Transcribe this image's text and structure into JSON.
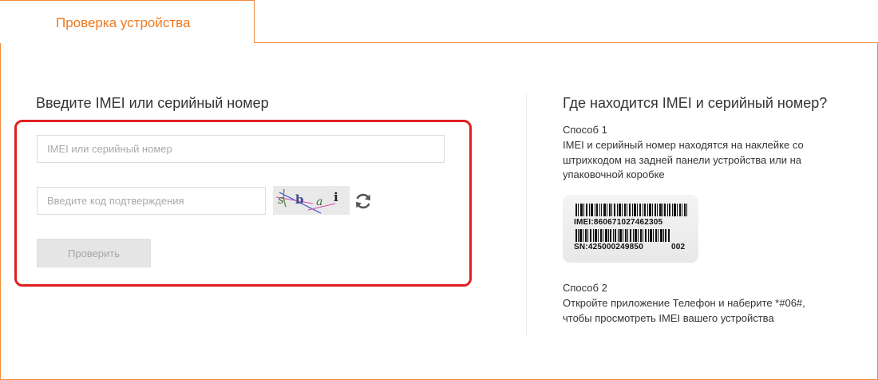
{
  "tab": {
    "label": "Проверка устройства"
  },
  "form": {
    "title": "Введите IMEI или серийный номер",
    "imei_placeholder": "IMEI или серийный номер",
    "code_placeholder": "Введите код подтверждения",
    "captcha_text": "s b a i",
    "submit_label": "Проверить"
  },
  "help": {
    "title": "Где находится IMEI и серийный номер?",
    "method1_label": "Способ 1",
    "method1_text": "IMEI и серийный номер находятся на наклейке со штрихкодом на задней панели устройства или на упаковочной коробке",
    "sticker": {
      "imei": "IMEI:860671027462305",
      "sn": "SN:425000249850",
      "code": "002"
    },
    "method2_label": "Способ 2",
    "method2_text": "Откройте приложение Телефон и наберите *#06#, чтобы просмотреть IMEI вашего устройства"
  },
  "colors": {
    "accent": "#f07a1e",
    "highlight": "#e02020",
    "button_bg": "#e5e5e5"
  }
}
